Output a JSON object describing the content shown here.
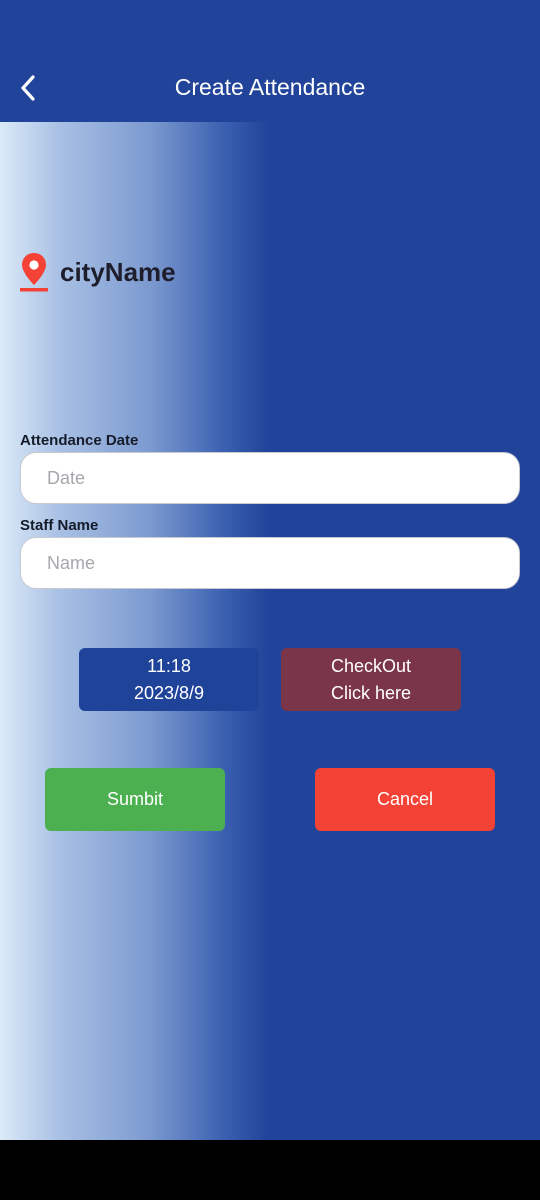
{
  "header": {
    "title": "Create Attendance",
    "back_icon": "chevron-left-icon"
  },
  "location": {
    "icon": "map-pin-icon",
    "icon_color": "#f44336",
    "city": "cityName"
  },
  "form": {
    "date_label": "Attendance Date",
    "date_placeholder": "Date",
    "date_value": "",
    "staff_label": "Staff Name",
    "staff_placeholder": "Name",
    "staff_value": ""
  },
  "clock": {
    "time": "11:18",
    "date": "2023/8/9"
  },
  "checkout": {
    "line1": "CheckOut",
    "line2": "Click here"
  },
  "actions": {
    "submit_label": "Sumbit",
    "cancel_label": "Cancel"
  },
  "colors": {
    "primary": "#21449a",
    "submit": "#4caf50",
    "cancel": "#f44336",
    "checkout": "#7b3548"
  }
}
